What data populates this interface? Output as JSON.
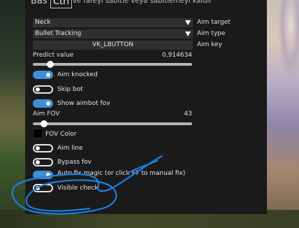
{
  "tabs": [
    {
      "label": "Bas"
    },
    {
      "label": "Ctrl"
    }
  ],
  "top_hint": "ve fareyi sabitle veya sabitlemeyi kaldır",
  "aim_target": {
    "value": "Neck",
    "label": "Aim target"
  },
  "aim_type": {
    "value": "Bullet Tracking",
    "label": "Aim type"
  },
  "aim_key": {
    "value": "VK_LBUTTON",
    "label": "Aim key"
  },
  "predict": {
    "label": "Predict value",
    "value_text": "0,914634",
    "fraction": 0.09
  },
  "toggles": [
    {
      "label": "Aim knocked",
      "on": true
    },
    {
      "label": "Skip bot",
      "on": false
    },
    {
      "label": "Show aimbot fov",
      "on": true
    }
  ],
  "aim_fov": {
    "label": "Aim FOV",
    "value_text": "43",
    "fraction": 0.05
  },
  "fov_color": {
    "label": "FOV Color",
    "color": "#000000"
  },
  "toggles2": [
    {
      "label": "Aim line",
      "on": false
    },
    {
      "label": "Bypass fov",
      "on": false
    },
    {
      "label": "Auto fix magic (or click F7 to manual fix)",
      "on": true
    },
    {
      "label": "Visible check",
      "on": false
    }
  ],
  "colors": {
    "accent": "#3f8fd8",
    "panel": "#1a1a1a",
    "scribble": "#1d7fe0"
  }
}
